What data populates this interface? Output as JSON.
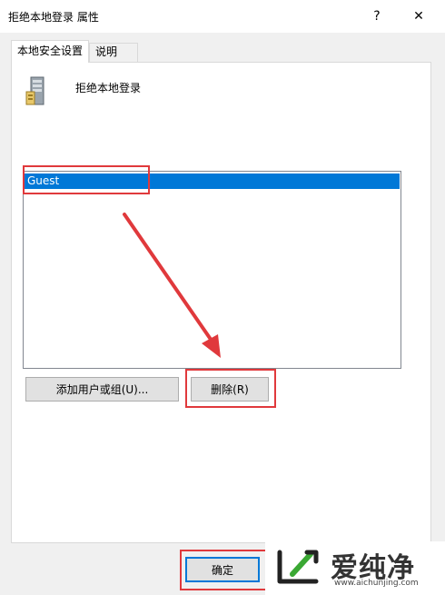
{
  "window": {
    "title": "拒绝本地登录 属性",
    "help_glyph": "?",
    "close_glyph": "✕"
  },
  "tabs": [
    {
      "label": "本地安全设置",
      "active": true
    },
    {
      "label": "说明",
      "active": false
    }
  ],
  "policy": {
    "icon": "server-icon",
    "name": "拒绝本地登录"
  },
  "user_list": {
    "items": [
      {
        "label": "Guest",
        "selected": true
      }
    ]
  },
  "buttons": {
    "add_label": "添加用户或组(U)...",
    "remove_label": "删除(R)",
    "ok_label": "确定"
  },
  "annotation": {
    "highlight_color": "#e0393c",
    "arrow": "red-arrow-pointing-to-remove-button"
  },
  "watermark": {
    "brand": "爱纯净",
    "url": "www.aichunjing.com",
    "logo_color": "#3aa833"
  },
  "colors": {
    "selection": "#0078d7",
    "focus_border": "#0078d7"
  }
}
